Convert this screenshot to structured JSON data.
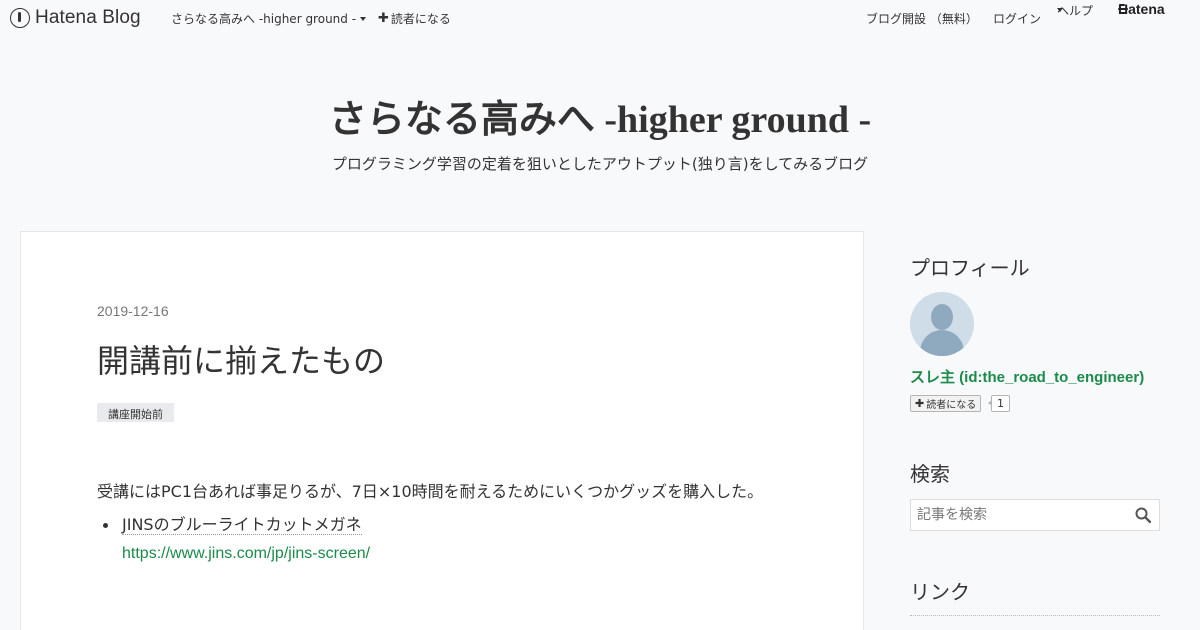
{
  "global_header": {
    "logo_text": "Hatena Blog",
    "blog_menu": "さらなる高みへ -higher ground -",
    "subscribe": "読者になる",
    "open_blog": "ブログ開設 （無料）",
    "login": "ログイン",
    "help": "ヘルプ",
    "hatena": "Hatena"
  },
  "blog": {
    "title": "さらなる高みへ -higher ground -",
    "description": "プログラミング学習の定着を狙いとしたアウトプット(独り言)をしてみるブログ"
  },
  "entry": {
    "date": "2019-12-16",
    "title": "開講前に揃えたもの",
    "category": "講座開始前",
    "paragraph": "受講にはPC1台あれば事足りるが、7日×10時間を耐えるためにいくつかグッズを購入した。",
    "items": [
      {
        "label": "JINSのブルーライトカットメガネ",
        "link": "https://www.jins.com/jp/jins-screen/"
      }
    ]
  },
  "sidebar": {
    "profile_heading": "プロフィール",
    "profile_name": "スレ主 (id:the_road_to_engineer)",
    "subscribe_label": "読者になる",
    "subscriber_count": "1",
    "search_heading": "検索",
    "search_placeholder": "記事を検索",
    "links_heading": "リンク"
  },
  "colors": {
    "accent_link": "#1a8b49",
    "background": "#f8f9fa"
  }
}
